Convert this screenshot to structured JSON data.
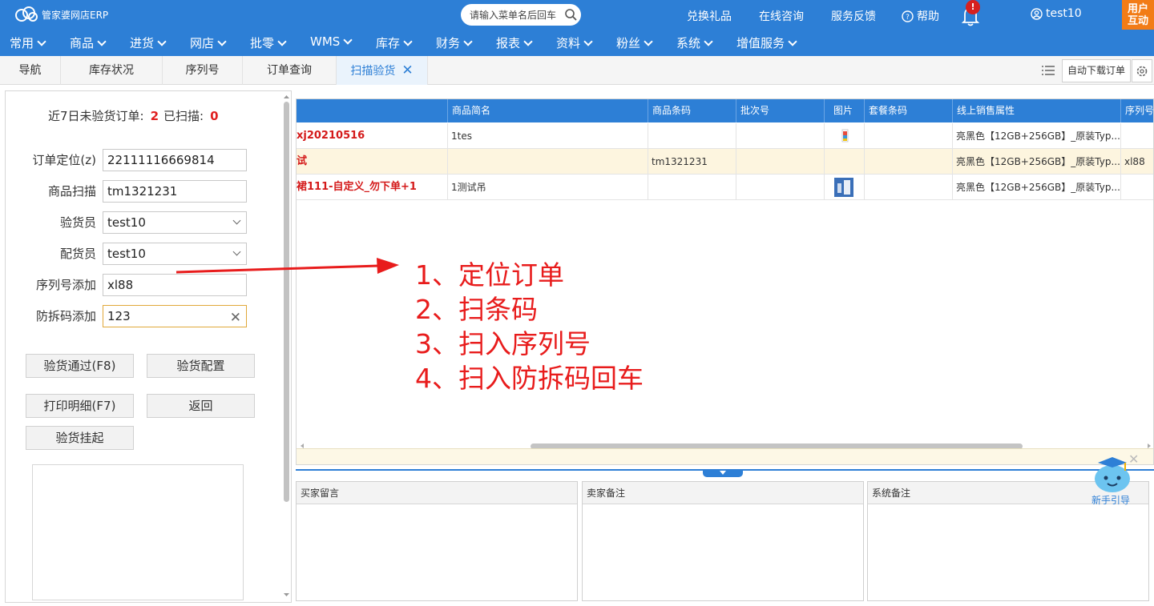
{
  "header": {
    "logo_text": "管家婆网店ERP",
    "search_placeholder": "请输入菜单名后回车",
    "links": [
      "兑换礼品",
      "在线咨询",
      "服务反馈",
      "帮助"
    ],
    "notification_count": "!",
    "username": "test10",
    "interact_line1": "用户",
    "interact_line2": "互动"
  },
  "menu": [
    "常用",
    "商品",
    "进货",
    "网店",
    "批零",
    "WMS",
    "库存",
    "财务",
    "报表",
    "资料",
    "粉丝",
    "系统",
    "增值服务"
  ],
  "tabs": [
    {
      "label": "导航"
    },
    {
      "label": "库存状况"
    },
    {
      "label": "序列号"
    },
    {
      "label": "订单查询"
    },
    {
      "label": "扫描验货",
      "active": true
    }
  ],
  "toolbar": {
    "auto_download": "自动下载订单"
  },
  "left": {
    "stat_unverified_label": "近7日未验货订单:",
    "stat_unverified": "2",
    "stat_scanned_label": "已扫描:",
    "stat_scanned": "0",
    "fields": [
      {
        "label": "订单定位(z)",
        "value": "22111116669814"
      },
      {
        "label": "商品扫描",
        "value": "tm1321231"
      },
      {
        "label": "验货员",
        "value": "test10"
      },
      {
        "label": "配货员",
        "value": "test10"
      },
      {
        "label": "序列号添加",
        "value": "xl88"
      },
      {
        "label": "防拆码添加",
        "value": "123"
      }
    ],
    "buttons": {
      "pass": "验货通过(F8)",
      "config": "验货配置",
      "print": "打印明细(F7)",
      "back": "返回",
      "hold": "验货挂起"
    }
  },
  "grid": {
    "columns": [
      "",
      "商品简名",
      "商品条码",
      "批次号",
      "图片",
      "套餐条码",
      "线上销售属性",
      "序列号"
    ],
    "rows": [
      [
        "xj20210516",
        "1tes",
        "",
        "",
        "",
        "",
        "亮黑色【12GB+256GB】_原装Typ...",
        ""
      ],
      [
        "试",
        "",
        "tm1321231",
        "",
        "",
        "",
        "亮黑色【12GB+256GB】_原装Typ...",
        "xl88"
      ],
      [
        "裙111-自定义_勿下单+1",
        "1测试吊",
        "",
        "",
        "",
        "",
        "亮黑色【12GB+256GB】_原装Typ...",
        ""
      ]
    ]
  },
  "notes": [
    "买家留言",
    "卖家备注",
    "系统备注"
  ],
  "annotation": [
    "1、定位订单",
    "2、扫条码",
    "3、扫入序列号",
    "4、扫入防拆码回车"
  ],
  "guide_label": "新手引导",
  "colors": {
    "primary": "#2d7fd6",
    "accent_orange": "#f27c16",
    "annotation_red": "#e81c1c"
  }
}
